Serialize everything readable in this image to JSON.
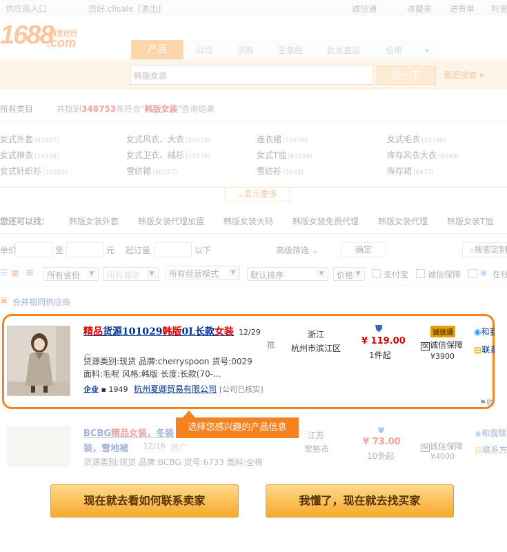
{
  "topbar": {
    "supplier_entry": "供应商入口",
    "greeting": "您好,clisale",
    "logout": "[退出]",
    "chengxintong": "诚信通",
    "favorites": "收藏夹",
    "purchase_list": "进货单",
    "ali": "阿里"
  },
  "logo": {
    "number": "1688",
    "cn": "阿里巴巴",
    "com": ".com"
  },
  "tabs": [
    {
      "label": "产品"
    },
    {
      "label": "公司"
    },
    {
      "label": "求购"
    },
    {
      "label": "生意经"
    },
    {
      "label": "批发直达"
    },
    {
      "label": "信用"
    }
  ],
  "search": {
    "value": "韩版女装",
    "button": "找一下",
    "recent": "最近搜索"
  },
  "results": {
    "all_categories": "所有类目",
    "prefix": "共找到",
    "count": "348753",
    "mid": "条符合\"",
    "keyword": "韩版女装",
    "suffix": "\"查询结果"
  },
  "categories": [
    {
      "name": "女式外套",
      "count": "(45807)"
    },
    {
      "name": "女式风衣、大衣",
      "count": "(26818)"
    },
    {
      "name": "连衣裙",
      "count": "(70476)"
    },
    {
      "name": "女式毛衣",
      "count": "(25746)"
    },
    {
      "name": "女式棉衣",
      "count": "(14108)"
    },
    {
      "name": "女式卫衣、绒衫",
      "count": "(19570)"
    },
    {
      "name": "女式T恤",
      "count": "(63159)"
    },
    {
      "name": "库存风衣大衣",
      "count": "(6089)"
    },
    {
      "name": "女式针织衫",
      "count": "(19363)"
    },
    {
      "name": "雪纺裙",
      "count": "(30757)"
    },
    {
      "name": "雪纺衫",
      "count": "(5635)"
    },
    {
      "name": "库存裙",
      "count": "(6477)"
    }
  ],
  "show_more": "显示更多",
  "also_find": {
    "label": "您还可以找：",
    "links": [
      "韩版女装外套",
      "韩版女装代理加盟",
      "韩版女装大码",
      "韩版女装免费代理",
      "韩版女装代理",
      "韩版女装T恤"
    ]
  },
  "filters": {
    "price_label": "单价",
    "to": "至",
    "unit": "元",
    "min_order": "起订量",
    "below": "以下",
    "advanced": "高级筛选",
    "confirm": "确定",
    "search_btn": "搜索定制"
  },
  "dropdowns": {
    "province": "所有省份",
    "city": "所有城市",
    "mode": "所有经营模式",
    "sort": "默认排序",
    "price": "价格",
    "alipay": "支付宝",
    "credit": "诚信保障",
    "online": "在线"
  },
  "merge": "合并相同供应商",
  "product1": {
    "t1": "精品",
    "t2": "货源101029",
    "t3": "韩版",
    "t4": "0L长款",
    "t5": "女装",
    "date": "12/29",
    "tui": "推广",
    "line1": "货源类别:现货 品牌:cherryspoon 货号:0029",
    "line2": "面料:毛呢 风格:韩版 长度:长款(70-...",
    "ent_label": "企业",
    "ent_years": "1949",
    "company": "杭州夏卿贸易有限公司",
    "verified": "[公司已核实]",
    "province": "浙江",
    "city": "杭州市滨江区",
    "price": "119.00",
    "currency": "¥",
    "min": "1件起",
    "badge": "诚信通",
    "guarantee": "诚信保障",
    "deposit": "¥3900",
    "contact1": "和我联系",
    "contact2": "联系方式",
    "fav": "收藏"
  },
  "product2": {
    "t1": "BCBG",
    "t2": "精品",
    "t3": "女装",
    "t4": "，冬装",
    "t5": "装，雪地裙",
    "date": "12/16",
    "tui": "推广",
    "line1": "货源类别:现货 品牌:BCBG 货号:6733 面料:全棉",
    "province": "江苏",
    "city": "常熟市",
    "price": "73.00",
    "currency": "¥",
    "min": "10条起",
    "guarantee": "诚信保障",
    "deposit": "¥4000",
    "contact1": "和我联",
    "contact2": "联系方"
  },
  "tooltip": "选择您感兴趣的产品信息",
  "buttons": {
    "learn": "现在就去看如何联系卖家",
    "find": "我懂了，现在就去找买家"
  }
}
